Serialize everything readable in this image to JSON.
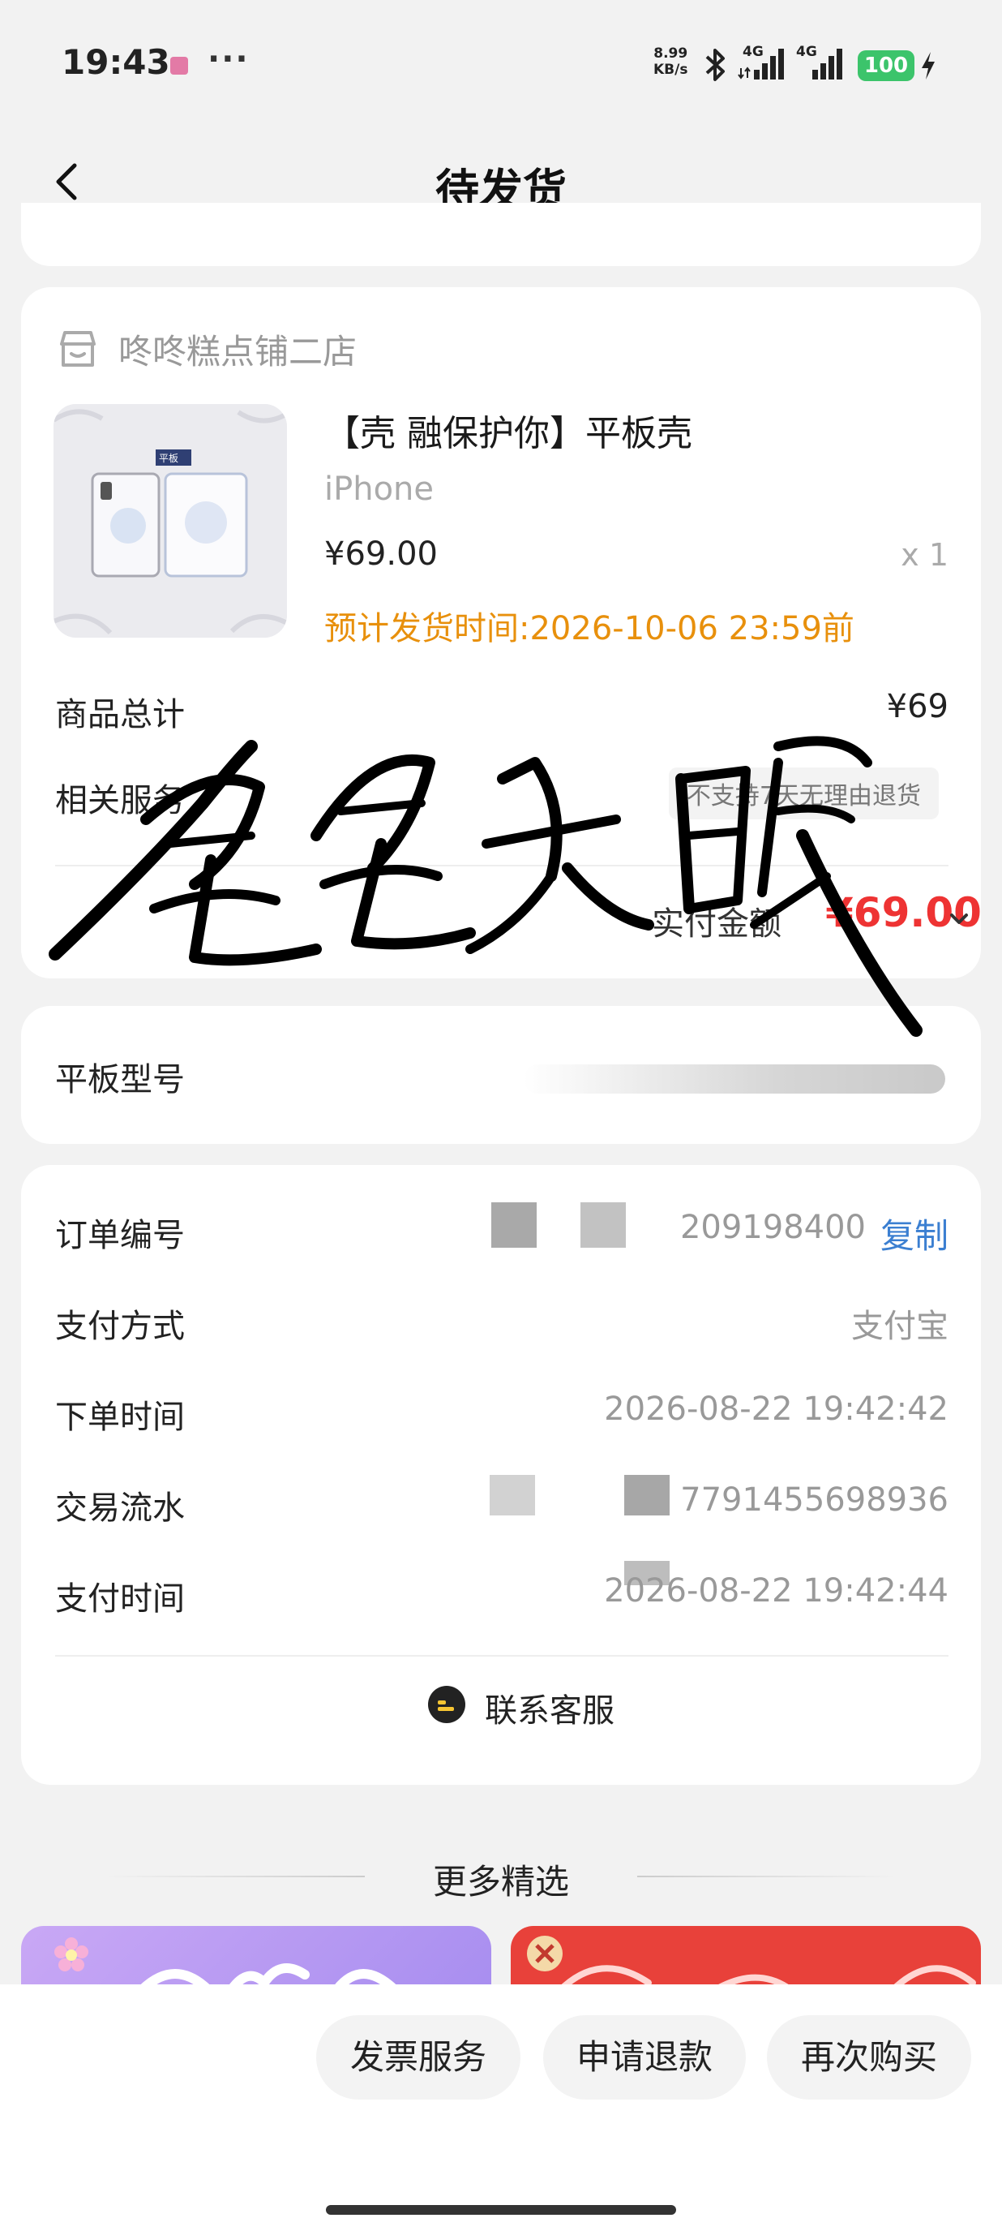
{
  "status_bar": {
    "time": "19:43",
    "net_speed_value": "8.99",
    "net_speed_unit": "KB/s",
    "network_1": "4G",
    "network_2": "4G",
    "battery": "100"
  },
  "header": {
    "title": "待发货"
  },
  "shop": {
    "name": "咚咚糕点铺二店"
  },
  "product": {
    "image_label": "平板",
    "title": "【壳 融保护你】平板壳",
    "spec": "iPhone",
    "price": "¥69.00",
    "quantity": "x 1",
    "ship_time": "预计发货时间:2026-10-06 23:59前"
  },
  "summary": {
    "total_label": "商品总计",
    "total_value": "¥69",
    "service_label": "相关服务",
    "service_tag": "不支持7天无理由退货",
    "paid_label": "实付金额",
    "paid_amount": "¥69.00"
  },
  "model": {
    "label": "平板型号"
  },
  "order": {
    "number_label": "订单编号",
    "number_value": "209198400",
    "copy_label": "复制",
    "pay_method_label": "支付方式",
    "pay_method_value": "支付宝",
    "order_time_label": "下单时间",
    "order_time_value": "2026-08-22 19:42:42",
    "trade_no_label": "交易流水",
    "trade_no_value": "7791455698936",
    "pay_time_label": "支付时间",
    "pay_time_value": "2026-08-22 19:42:44",
    "contact_label": "联系客服"
  },
  "more": {
    "title": "更多精选"
  },
  "actions": {
    "invoice": "发票服务",
    "refund": "申请退款",
    "rebuy": "再次购买"
  },
  "colors": {
    "accent_red": "#e33333",
    "ship_orange": "#e8900c",
    "link_blue": "#3b7fd1",
    "battery_green": "#3cc46b"
  }
}
